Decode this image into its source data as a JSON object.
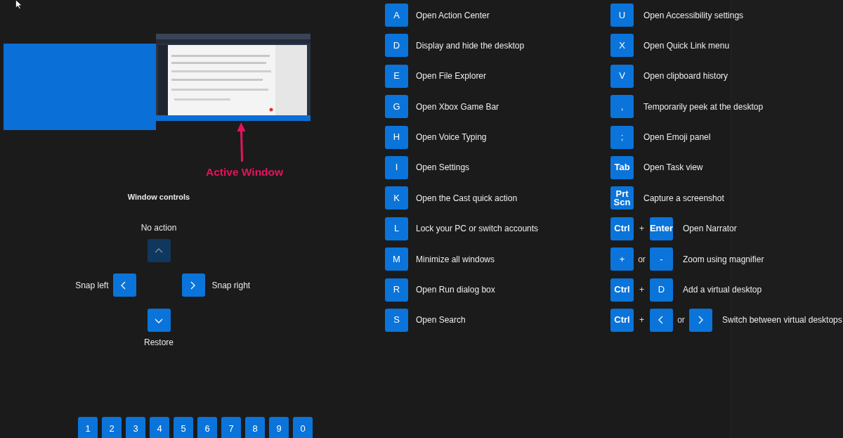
{
  "active_window_label": "Active Window",
  "window_controls": {
    "title": "Window controls",
    "up": {
      "label": "No action",
      "disabled": true
    },
    "left": {
      "label": "Snap left",
      "disabled": false
    },
    "right": {
      "label": "Snap right",
      "disabled": false
    },
    "down": {
      "label": "Restore",
      "disabled": false
    }
  },
  "number_keys": [
    "1",
    "2",
    "3",
    "4",
    "5",
    "6",
    "7",
    "8",
    "9",
    "0"
  ],
  "shortcuts_left": [
    {
      "keys": [
        {
          "kind": "key",
          "text": "A"
        }
      ],
      "label": "Open Action Center"
    },
    {
      "keys": [
        {
          "kind": "key",
          "text": "D"
        }
      ],
      "label": "Display and hide the desktop"
    },
    {
      "keys": [
        {
          "kind": "key",
          "text": "E"
        }
      ],
      "label": "Open File Explorer"
    },
    {
      "keys": [
        {
          "kind": "key",
          "text": "G"
        }
      ],
      "label": "Open Xbox Game Bar"
    },
    {
      "keys": [
        {
          "kind": "key",
          "text": "H"
        }
      ],
      "label": "Open Voice Typing"
    },
    {
      "keys": [
        {
          "kind": "key",
          "text": "I"
        }
      ],
      "label": "Open Settings"
    },
    {
      "keys": [
        {
          "kind": "key",
          "text": "K"
        }
      ],
      "label": "Open the Cast quick action"
    },
    {
      "keys": [
        {
          "kind": "key",
          "text": "L"
        }
      ],
      "label": "Lock your PC or switch accounts"
    },
    {
      "keys": [
        {
          "kind": "key",
          "text": "M"
        }
      ],
      "label": "Minimize all windows"
    },
    {
      "keys": [
        {
          "kind": "key",
          "text": "R"
        }
      ],
      "label": "Open Run dialog box"
    },
    {
      "keys": [
        {
          "kind": "key",
          "text": "S"
        }
      ],
      "label": "Open Search"
    }
  ],
  "shortcuts_right": [
    {
      "keys": [
        {
          "kind": "key",
          "text": "U"
        }
      ],
      "label": "Open Accessibility settings"
    },
    {
      "keys": [
        {
          "kind": "key",
          "text": "X"
        }
      ],
      "label": "Open Quick Link menu"
    },
    {
      "keys": [
        {
          "kind": "key",
          "text": "V"
        }
      ],
      "label": "Open clipboard history"
    },
    {
      "keys": [
        {
          "kind": "key",
          "text": ","
        }
      ],
      "label": "Temporarily peek at the desktop"
    },
    {
      "keys": [
        {
          "kind": "key",
          "text": ";"
        }
      ],
      "label": "Open Emoji panel"
    },
    {
      "keys": [
        {
          "kind": "key",
          "text": "Tab"
        }
      ],
      "label": "Open Task view"
    },
    {
      "keys": [
        {
          "kind": "key",
          "text": "Prt Scn"
        }
      ],
      "label": "Capture a screenshot"
    },
    {
      "keys": [
        {
          "kind": "key",
          "text": "Ctrl"
        },
        {
          "kind": "join",
          "text": "+"
        },
        {
          "kind": "key",
          "text": "Enter"
        }
      ],
      "label": "Open Narrator"
    },
    {
      "keys": [
        {
          "kind": "key",
          "text": "+"
        },
        {
          "kind": "join",
          "text": "or"
        },
        {
          "kind": "key",
          "text": "-"
        }
      ],
      "label": "Zoom using magnifier"
    },
    {
      "keys": [
        {
          "kind": "key",
          "text": "Ctrl"
        },
        {
          "kind": "join",
          "text": "+"
        },
        {
          "kind": "key",
          "text": "D"
        }
      ],
      "label": "Add a virtual desktop"
    },
    {
      "keys": [
        {
          "kind": "key",
          "text": "Ctrl"
        },
        {
          "kind": "join",
          "text": "+"
        },
        {
          "kind": "arrow_left"
        },
        {
          "kind": "join",
          "text": "or"
        },
        {
          "kind": "arrow_right"
        }
      ],
      "label": "Switch between virtual desktops"
    }
  ]
}
